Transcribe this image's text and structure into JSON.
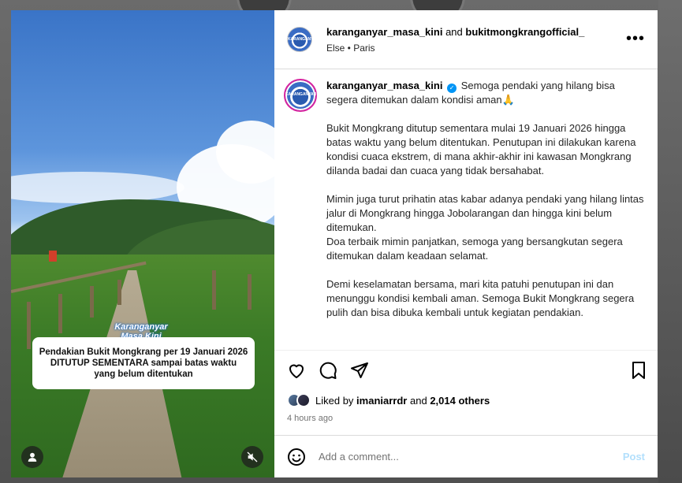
{
  "post": {
    "author": "karanganyar_masa_kini",
    "and_label": "and",
    "collaborator": "bukitmongkrangofficial_",
    "location": "Else • Paris",
    "more_label": "•••",
    "avatar_text": "KARANGANYAR"
  },
  "media": {
    "watermark": "Karanganyar Masa Kini",
    "overlay_text": "Pendakian Bukit Mongkrang per 19 Januari 2026 DITUTUP SEMENTARA sampai batas waktu yang belum ditentukan"
  },
  "caption": {
    "username": "karanganyar_masa_kini",
    "line1": "Semoga pendaki yang hilang bisa segera ditemukan dalam kondisi aman🙏",
    "para2": "Bukit Mongkrang ditutup sementara mulai 19 Januari 2026 hingga batas waktu yang belum ditentukan. Penutupan ini dilakukan karena kondisi cuaca ekstrem, di mana akhir-akhir ini kawasan Mongkrang dilanda badai dan cuaca yang tidak bersahabat.",
    "para3a": "Mimin juga turut prihatin atas kabar adanya pendaki yang hilang lintas jalur di Mongkrang hingga Jobolarangan dan hingga kini belum ditemukan.",
    "para3b": "Doa terbaik mimin panjatkan, semoga yang bersangkutan segera ditemukan dalam keadaan selamat.",
    "para4": "Demi keselamatan bersama, mari kita patuhi penutupan ini dan menunggu kondisi kembali aman. Semoga Bukit Mongkrang segera pulih dan bisa dibuka kembali untuk kegiatan pendakian."
  },
  "engagement": {
    "liked_by_label": "Liked by",
    "liked_user": "imaniarrdr",
    "and_label": "and",
    "others": "2,014 others",
    "time": "4 hours ago"
  },
  "comment": {
    "placeholder": "Add a comment...",
    "post_label": "Post"
  },
  "icons": [
    "heart-icon",
    "comment-icon",
    "share-icon",
    "bookmark-icon",
    "emoji-icon",
    "user-tag-icon",
    "mute-icon",
    "verified-icon"
  ]
}
